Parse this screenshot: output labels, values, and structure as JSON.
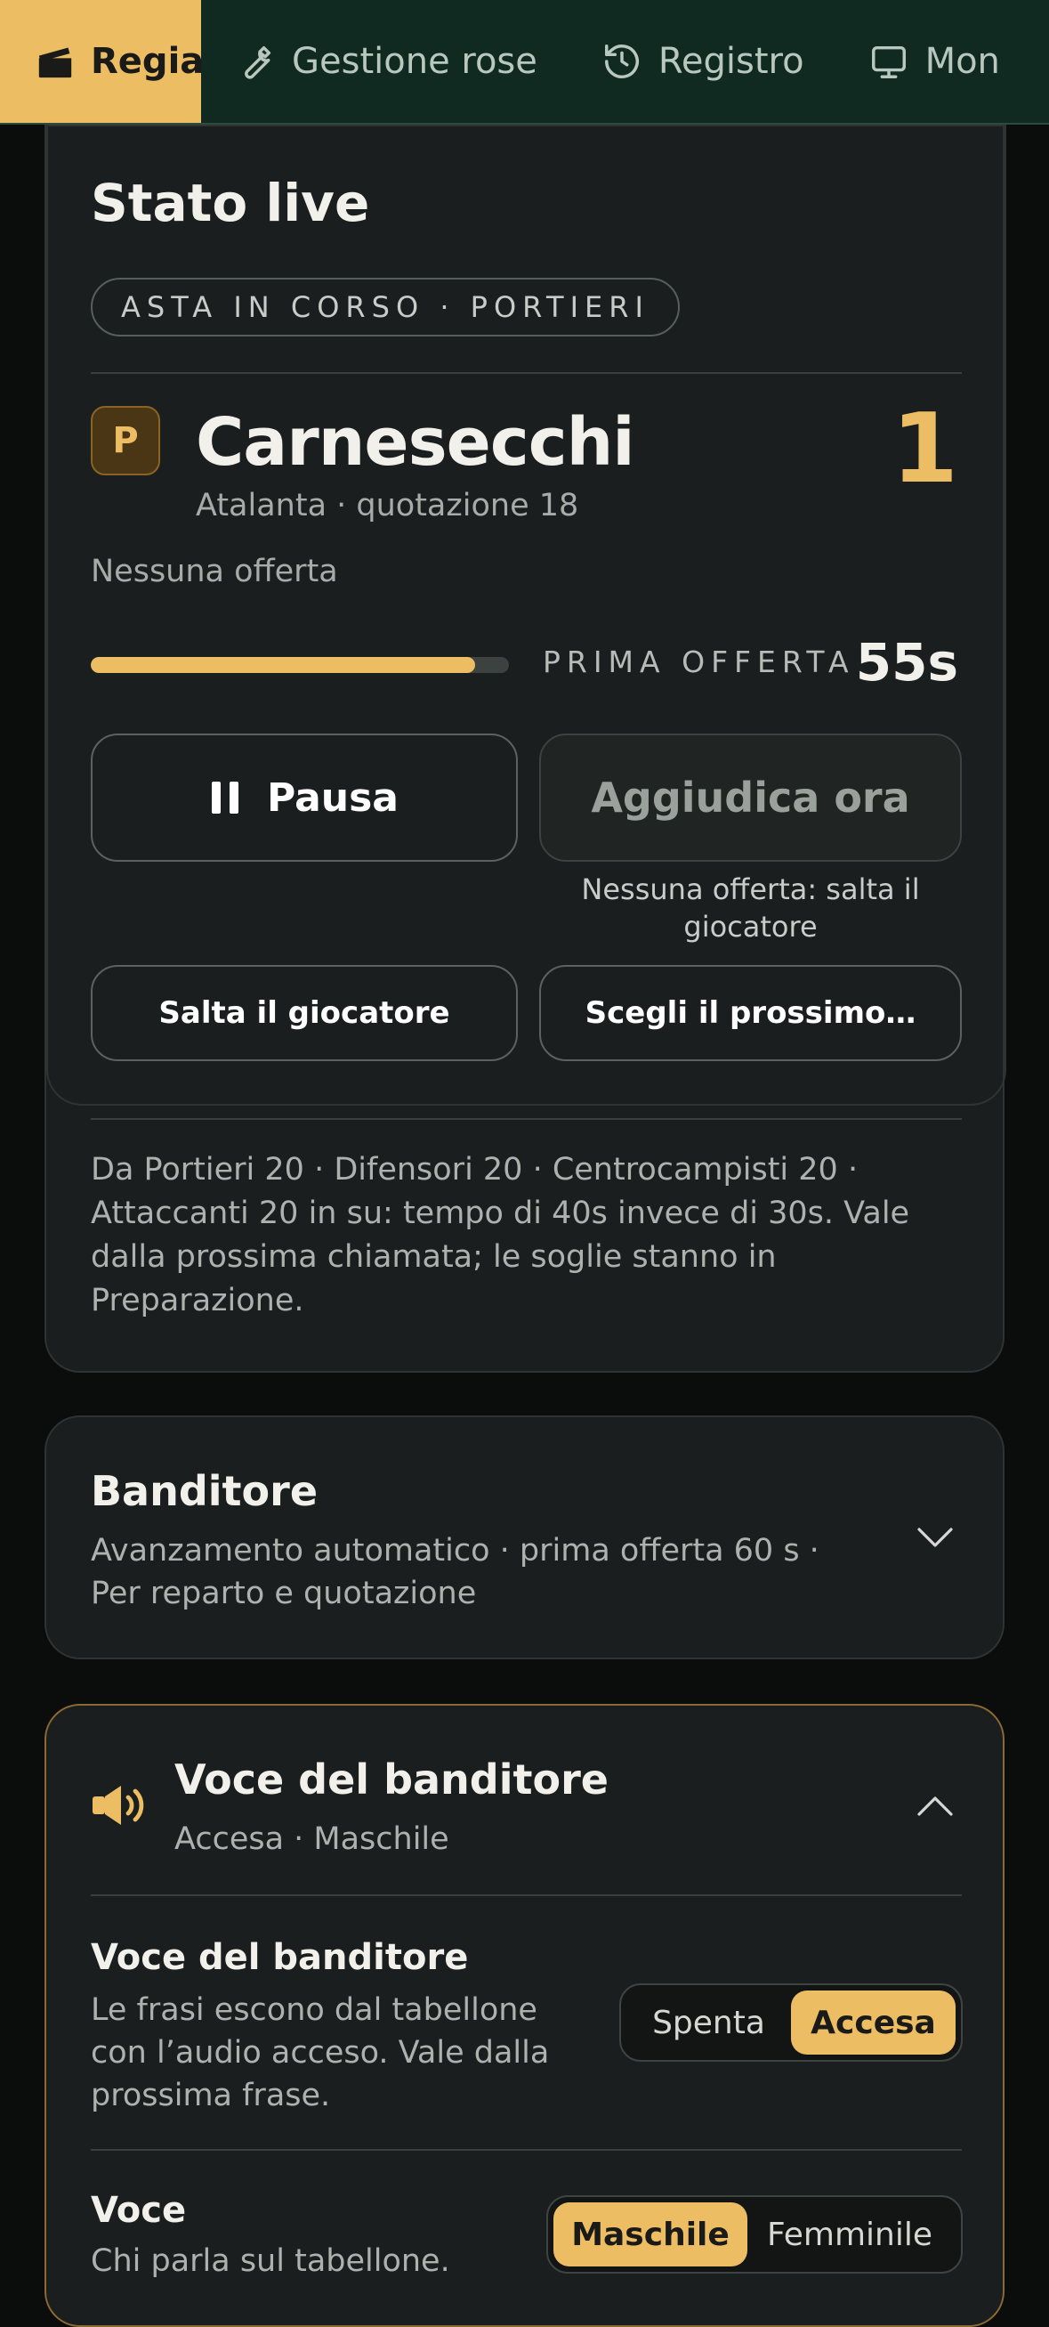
{
  "nav": {
    "tabs": [
      {
        "label": "Regia",
        "icon": "clapperboard-icon",
        "active": true
      },
      {
        "label": "Gestione rose",
        "icon": "wrench-icon"
      },
      {
        "label": "Registro",
        "icon": "history-icon"
      },
      {
        "label": "Mon",
        "icon": "monitor-icon"
      }
    ]
  },
  "live": {
    "title": "Stato live",
    "status_pill": "ASTA IN CORSO · PORTIERI",
    "role_badge": "P",
    "player_name": "Carnesecchi",
    "player_meta": "Atalanta · quotazione 18",
    "bid_count": "1",
    "no_offer": "Nessuna offerta",
    "progress": 0.92,
    "timer_label": "PRIMA OFFERTA",
    "timer_value": "55s",
    "pause_label": "Pausa",
    "award_label": "Aggiudica ora",
    "award_hint": "Nessuna offerta: salta il giocatore",
    "skip_label": "Salta il giocatore",
    "choose_next_label": "Scegli il prossimo…",
    "footnote": "Da Portieri 20 · Difensori 20 · Centrocampisti 20 · Attaccanti 20 in su: tempo di 40s invece di 30s. Vale dalla prossima chiamata; le soglie stanno in Preparazione."
  },
  "auctioneer": {
    "title": "Banditore",
    "subtitle": "Avanzamento automatico · prima offerta 60 s · Per reparto e quotazione"
  },
  "voice": {
    "title": "Voce del banditore",
    "subtitle": "Accesa · Maschile",
    "setting1": {
      "title": "Voce del banditore",
      "desc": "Le frasi escono dal tabellone con l’audio acceso. Vale dalla prossima frase.",
      "off_label": "Spenta",
      "on_label": "Accesa",
      "selected": "Accesa"
    },
    "setting2": {
      "title": "Voce",
      "desc": "Chi parla sul tabellone.",
      "male_label": "Maschile",
      "female_label": "Femminile",
      "selected": "Maschile"
    }
  },
  "colors": {
    "accent": "#ecbd62",
    "nav_bg": "#112a21",
    "card_bg": "#1b1e1e",
    "page_bg": "#0b0d0c"
  }
}
